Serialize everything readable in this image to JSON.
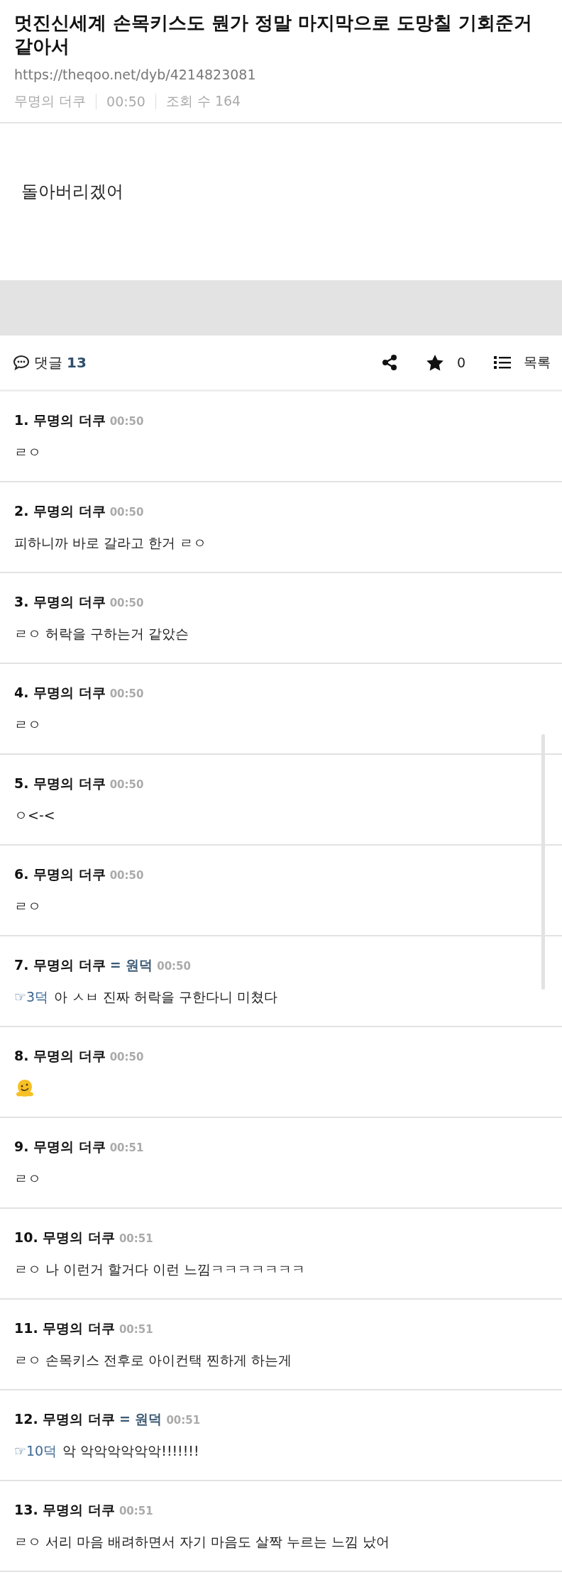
{
  "post": {
    "title": "멋진신세계 손목키스도 뭔가 정말 마지막으로 도망칠 기회준거 같아서",
    "url": "https://theqoo.net/dyb/4214823081",
    "author": "무명의 더쿠",
    "time": "00:50",
    "views": "조회 수 164",
    "body": "돌아버리겠어"
  },
  "toolbar": {
    "comments_label": "댓글",
    "comments_count": "13",
    "favorites": "0",
    "list_label": "목록"
  },
  "comments": [
    {
      "number": "1.",
      "author": "무명의 더쿠",
      "time": "00:50",
      "kind": "text",
      "body": "ㄹㅇ"
    },
    {
      "number": "2.",
      "author": "무명의 더쿠",
      "time": "00:50",
      "kind": "text",
      "body": "피하니까 바로 갈라고 한거 ㄹㅇ"
    },
    {
      "number": "3.",
      "author": "무명의 더쿠",
      "time": "00:50",
      "kind": "text",
      "body": "ㄹㅇ 허락을 구하는거 같았슨"
    },
    {
      "number": "4.",
      "author": "무명의 더쿠",
      "time": "00:50",
      "kind": "text",
      "body": "ㄹㅇ"
    },
    {
      "number": "5.",
      "author": "무명의 더쿠",
      "time": "00:50",
      "kind": "text",
      "body": "ㅇ<-<"
    },
    {
      "number": "6.",
      "author": "무명의 더쿠",
      "time": "00:50",
      "kind": "text",
      "body": "ㄹㅇ"
    },
    {
      "number": "7.",
      "author": "무명의 더쿠",
      "op_tag": "= 원덕",
      "time": "00:50",
      "kind": "text",
      "reply_to": "☞3덕",
      "body": "아 ㅅㅂ 진짜 허락을 구한다니 미쳤다"
    },
    {
      "number": "8.",
      "author": "무명의 더쿠",
      "time": "00:50",
      "kind": "emoji"
    },
    {
      "number": "9.",
      "author": "무명의 더쿠",
      "time": "00:51",
      "kind": "text",
      "body": "ㄹㅇ"
    },
    {
      "number": "10.",
      "author": "무명의 더쿠",
      "time": "00:51",
      "kind": "text",
      "body": "ㄹㅇ 나 이런거 할거다 이런 느낌ㅋㅋㅋㅋㅋㅋㅋ"
    },
    {
      "number": "11.",
      "author": "무명의 더쿠",
      "time": "00:51",
      "kind": "text",
      "body": "ㄹㅇ 손목키스 전후로 아이컨택 찐하게 하는게"
    },
    {
      "number": "12.",
      "author": "무명의 더쿠",
      "op_tag": "= 원덕",
      "time": "00:51",
      "kind": "text",
      "reply_to": "☞10덕",
      "body": "악 악악악악악악!!!!!!!"
    },
    {
      "number": "13.",
      "author": "무명의 더쿠",
      "time": "00:51",
      "kind": "text",
      "body": "ㄹㅇ 서리 마음 배려하면서 자기 마음도 살짝 누르는 느낌 났어"
    }
  ]
}
